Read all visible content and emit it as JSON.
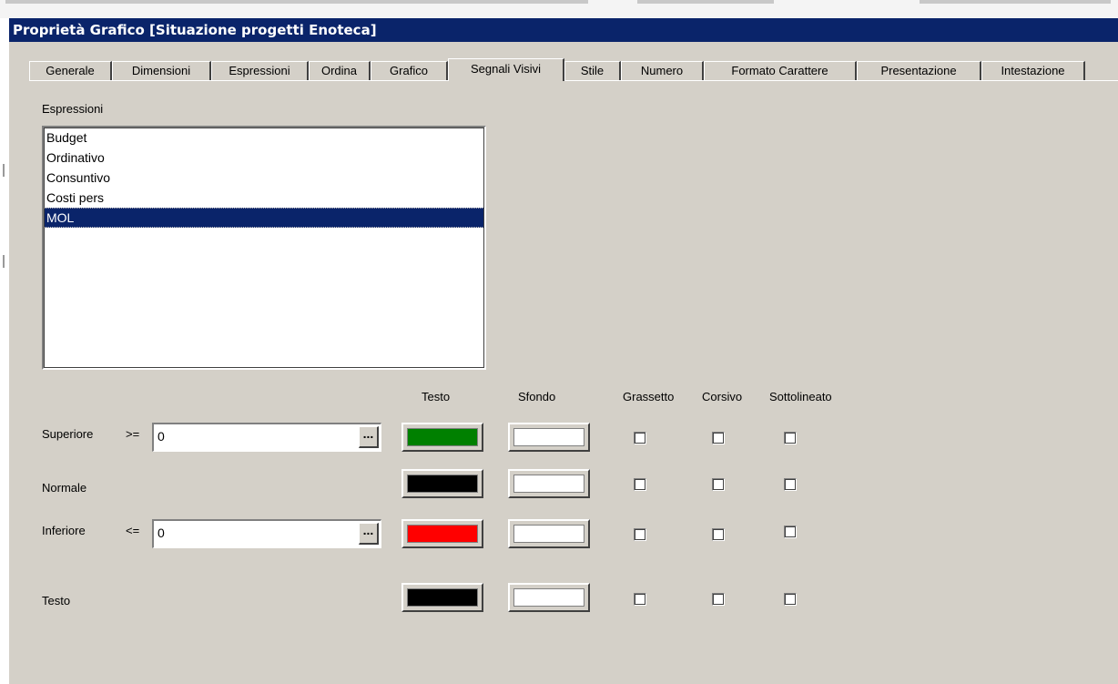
{
  "window": {
    "title": "Proprietà Grafico [Situazione progetti Enoteca]"
  },
  "tabs": [
    {
      "label": "Generale"
    },
    {
      "label": "Dimensioni"
    },
    {
      "label": "Espressioni"
    },
    {
      "label": "Ordina"
    },
    {
      "label": "Grafico"
    },
    {
      "label": "Segnali Visivi",
      "active": true
    },
    {
      "label": "Stile"
    },
    {
      "label": "Numero"
    },
    {
      "label": "Formato Carattere"
    },
    {
      "label": "Presentazione"
    },
    {
      "label": "Intestazione"
    }
  ],
  "expressions": {
    "label": "Espressioni",
    "items": [
      "Budget",
      "Ordinativo",
      "Consuntivo",
      "Costi pers",
      "MOL"
    ],
    "selected": "MOL"
  },
  "columns": {
    "testo": "Testo",
    "sfondo": "Sfondo",
    "grassetto": "Grassetto",
    "corsivo": "Corsivo",
    "sottolineato": "Sottolineato"
  },
  "rows": {
    "superiore": {
      "label": "Superiore",
      "op": ">=",
      "value": "0",
      "text_color": "#008000",
      "bg_color": "#ffffff"
    },
    "normale": {
      "label": "Normale",
      "text_color": "#000000",
      "bg_color": "#ffffff"
    },
    "inferiore": {
      "label": "Inferiore",
      "op": "<=",
      "value": "0",
      "text_color": "#ff0000",
      "bg_color": "#ffffff"
    },
    "testo": {
      "label": "Testo",
      "text_color": "#000000",
      "bg_color": "#ffffff"
    }
  },
  "ellipsis_label": "...",
  "theme": {
    "titlebar": "#0a246a",
    "face": "#d4d0c8",
    "selection": "#0a246a"
  }
}
